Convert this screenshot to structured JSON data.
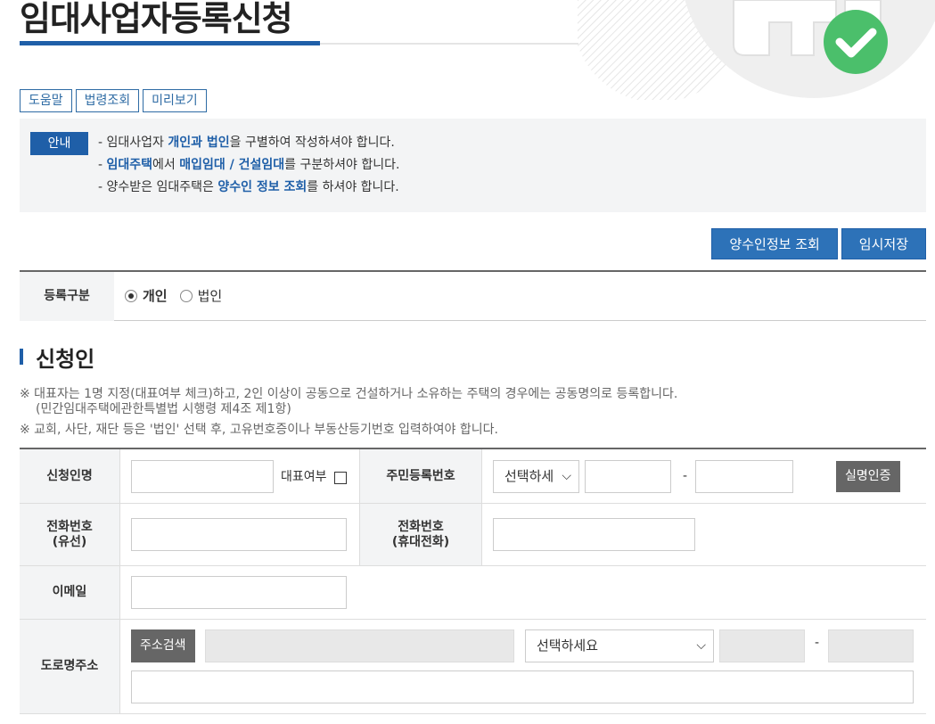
{
  "header": {
    "title": "임대사업자등록신청"
  },
  "top_buttons": {
    "help": "도움말",
    "law": "법령조회",
    "preview": "미리보기"
  },
  "notice": {
    "badge": "안내",
    "line1_a": "- 임대사업자 ",
    "line1_b": "개인과 법인",
    "line1_c": "을 구별하여 작성하셔야 합니다.",
    "line2_a": "- ",
    "line2_b": "임대주택",
    "line2_c": "에서 ",
    "line2_d": "매입임대 / 건설임대",
    "line2_e": "를 구분하셔야 합니다.",
    "line3_a": "- 양수받은 임대주택은 ",
    "line3_b": "양수인 정보 조회",
    "line3_c": "를 하셔야 합니다."
  },
  "actions": {
    "transferee_lookup": "양수인정보 조회",
    "temp_save": "임시저장"
  },
  "registration": {
    "label": "등록구분",
    "options": [
      {
        "label": "개인",
        "selected": true
      },
      {
        "label": "법인",
        "selected": false
      }
    ]
  },
  "section": {
    "title": "신청인"
  },
  "notes": {
    "line1": "※ 대표자는 1명 지정(대표여부 체크)하고, 2인 이상이 공동으로 건설하거나 소유하는 주택의 경우에는 공동명의로 등록합니다.",
    "line2": "(민간임대주택에관한특별법 시행령 제4조 제1항)",
    "line3": "※ 교회, 사단, 재단 등은 '법인' 선택 후, 고유번호증이나 부동산등기번호 입력하여야 합니다."
  },
  "form": {
    "applicant_name_label": "신청인명",
    "representative_label": "대표여부",
    "resident_no_label": "주민등록번호",
    "resident_select_value": "선택하세",
    "dash": "-",
    "verify_button": "실명인증",
    "phone_wired_label_1": "전화번호",
    "phone_wired_label_2": "(유선)",
    "phone_mobile_label_1": "전화번호",
    "phone_mobile_label_2": "(휴대전화)",
    "email_label": "이메일",
    "road_address_label": "도로명주소",
    "address_search_button": "주소검색",
    "address_select_value": "선택하세요"
  },
  "colors": {
    "primary": "#1f5fa8",
    "button": "#2d72b8",
    "dark_button": "#666666",
    "label_bg": "#f3f4f5"
  }
}
